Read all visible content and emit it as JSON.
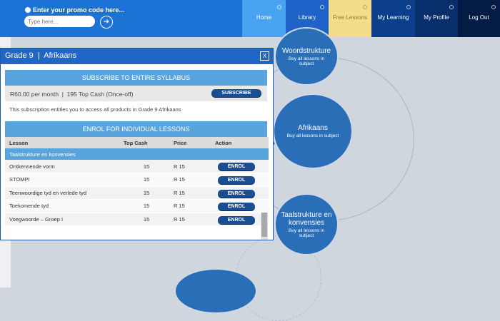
{
  "header": {
    "promo_label": "Enter your promo code here...",
    "promo_placeholder": "Type here...",
    "nav": [
      {
        "label": "Home"
      },
      {
        "label": "Library"
      },
      {
        "label": "Free Lessons"
      },
      {
        "label": "My Learning"
      },
      {
        "label": "My Profile"
      },
      {
        "label": "Log Out"
      }
    ]
  },
  "modal": {
    "title": "Grade 9  |  Afrikaans",
    "close": "X",
    "subscribe": {
      "heading": "SUBSCRIBE TO ENTIRE SYLLABUS",
      "price": "R60.00 per month  |  195 Top Cash (Once-off)",
      "button": "SUBSCRIBE",
      "note": "This subscription entitles you to access all products in Grade 9 Afrikaans"
    },
    "enrol": {
      "heading": "ENROL FOR INDIVIDUAL LESSONS",
      "columns": [
        "Lesson",
        "Top Cash",
        "Price",
        "Action"
      ],
      "category": "Taalstrukture en konvensies",
      "rows": [
        {
          "lesson": "Ontkennende vorm",
          "topcash": "15",
          "price": "R 15",
          "action": "ENROL"
        },
        {
          "lesson": "STOMPI",
          "topcash": "15",
          "price": "R 15",
          "action": "ENROL"
        },
        {
          "lesson": "Teenwoordige tyd en verlede tyd",
          "topcash": "15",
          "price": "R 15",
          "action": "ENROL"
        },
        {
          "lesson": "Toekomende tyd",
          "topcash": "15",
          "price": "R 15",
          "action": "ENROL"
        },
        {
          "lesson": "Voegwoorde – Groep I",
          "topcash": "15",
          "price": "R 15",
          "action": "ENROL"
        }
      ]
    }
  },
  "nodes": {
    "woordstrukture": {
      "title": "Woordstrukture",
      "sub": "Buy all lessons in subject"
    },
    "afrikaans": {
      "title": "Afrikaans",
      "sub": "Buy all lessons in subject"
    },
    "taalstrukture": {
      "title": "Taalstrukture en konvensies",
      "sub": "Buy all lessons in subject"
    }
  },
  "colors": {
    "nav_home": "#4aa3f0",
    "nav_library": "#1f62c8",
    "nav_free": "#f3dd8c",
    "nav_learning": "#0b3f8c",
    "nav_profile": "#082e6b",
    "nav_logout": "#041c45"
  }
}
